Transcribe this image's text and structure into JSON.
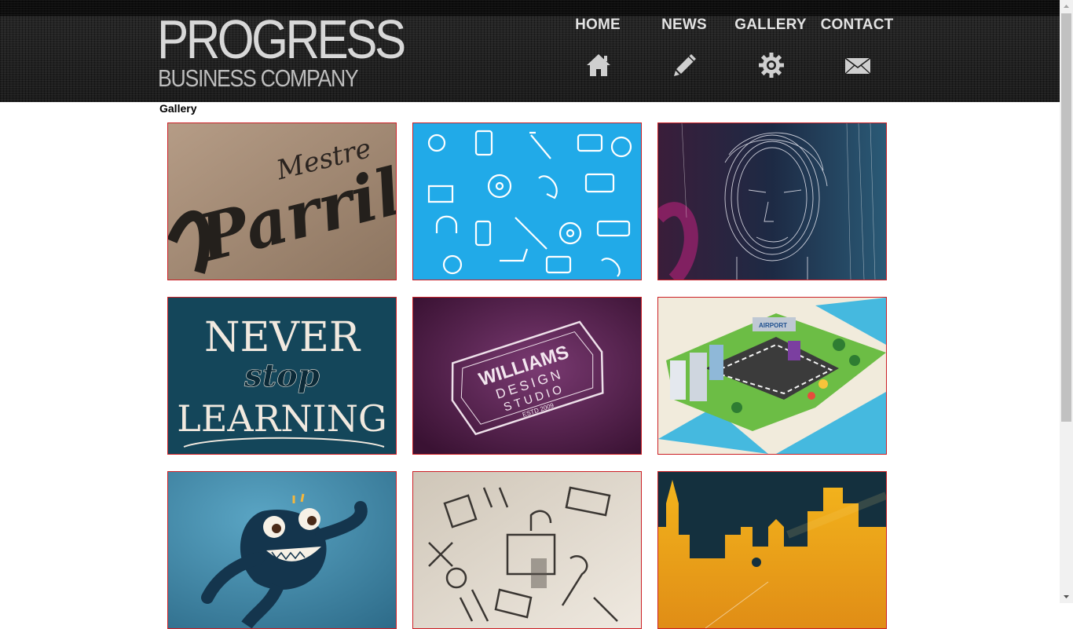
{
  "brand": {
    "title": "PROGRESS",
    "subtitle": "BUSINESS COMPANY"
  },
  "nav": [
    {
      "label": "HOME",
      "icon": "home-icon"
    },
    {
      "label": "NEWS",
      "icon": "pencil-icon"
    },
    {
      "label": "GALLERY",
      "icon": "gear-icon"
    },
    {
      "label": "CONTACT",
      "icon": "envelope-icon"
    }
  ],
  "page": {
    "title": "Gallery"
  },
  "gallery": {
    "tiles": [
      {
        "name": "mestre-parrilla-lettering",
        "text": [
          "Mestre",
          "Parrill"
        ]
      },
      {
        "name": "blue-music-pattern"
      },
      {
        "name": "line-art-portrait"
      },
      {
        "name": "never-stop-learning-lettering",
        "text": [
          "NEVER",
          "stop",
          "LEARNING"
        ]
      },
      {
        "name": "williams-design-studio-logo",
        "text": [
          "WILLIAMS",
          "DESIGN",
          "STUDIO",
          "ESTD 2009"
        ]
      },
      {
        "name": "isometric-city-map",
        "text": [
          "AIRPORT"
        ]
      },
      {
        "name": "blue-monster-illustration"
      },
      {
        "name": "tools-sketch"
      },
      {
        "name": "yellow-city-skyline"
      }
    ]
  },
  "colors": {
    "header_bg": "#1c1c1c",
    "tile_border": "#cc1f25",
    "nav_text": "#e2e2e2"
  }
}
